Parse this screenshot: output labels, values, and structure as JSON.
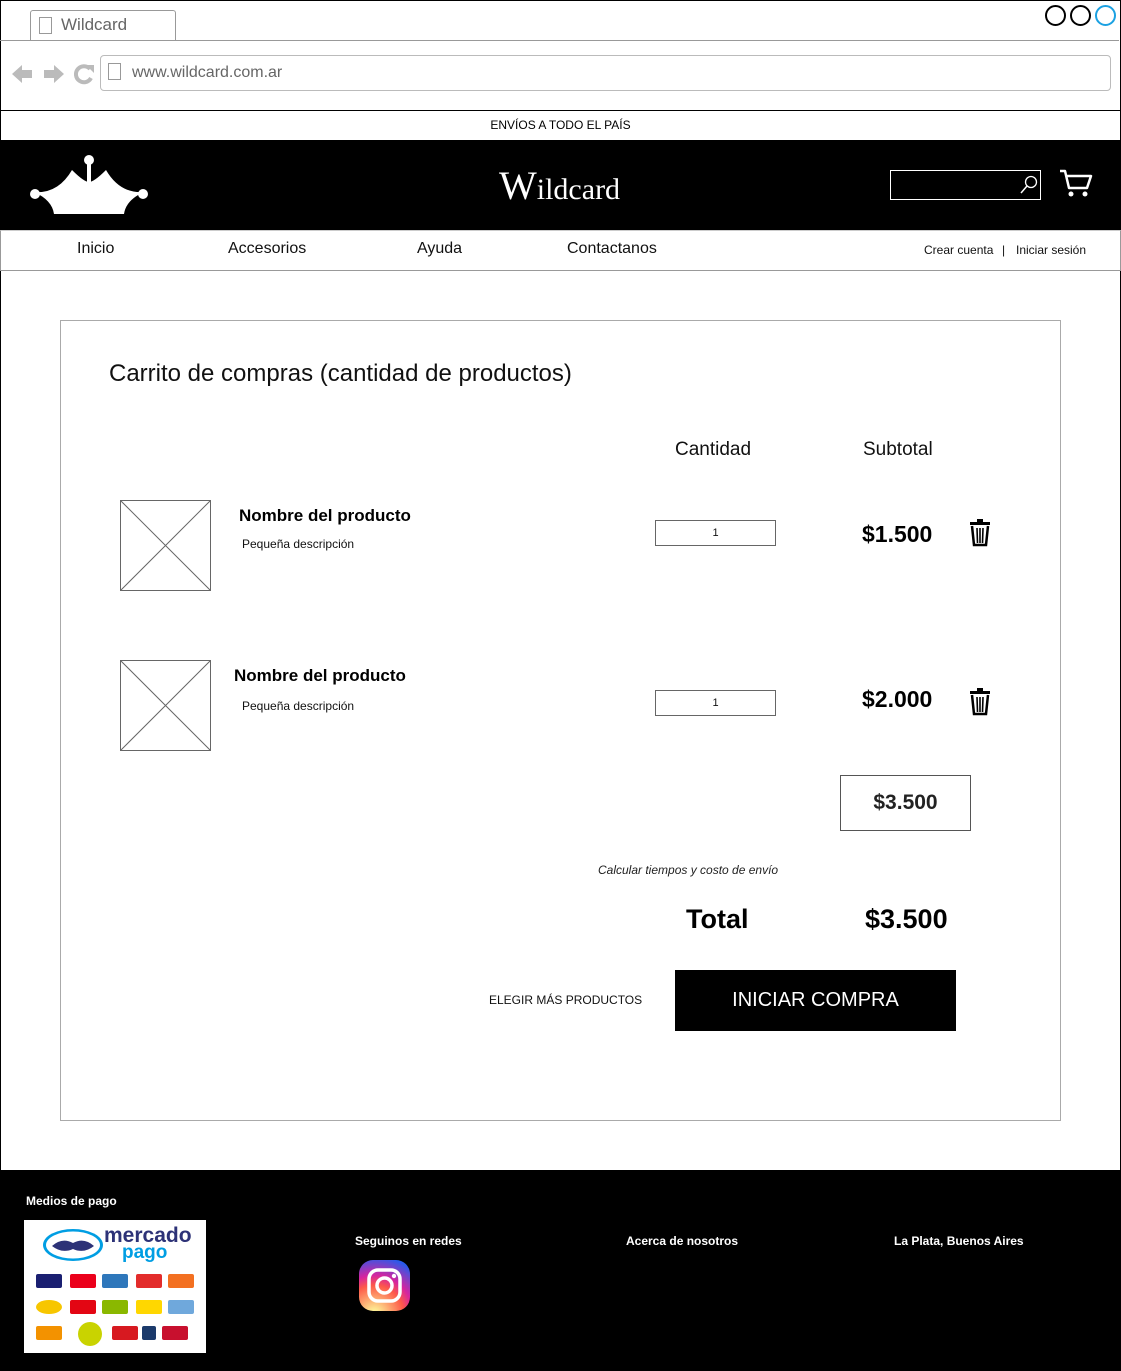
{
  "browser": {
    "tab_title": "Wildcard",
    "url": "www.wildcard.com.ar"
  },
  "promo_bar": "ENVÍOS A TODO EL PAÍS",
  "header": {
    "brand_initial": "W",
    "brand_rest": "ildcard"
  },
  "nav": {
    "items": [
      "Inicio",
      "Accesorios",
      "Ayuda",
      "Contactanos"
    ],
    "create_account": "Crear cuenta",
    "separator": "|",
    "login": "Iniciar sesión"
  },
  "cart": {
    "title": "Carrito de compras (cantidad de productos)",
    "col_quantity": "Cantidad",
    "col_subtotal": "Subtotal",
    "items": [
      {
        "name": "Nombre del producto",
        "description": "Pequeña descripción",
        "quantity": "1",
        "subtotal": "$1.500"
      },
      {
        "name": "Nombre del producto",
        "description": "Pequeña descripción",
        "quantity": "1",
        "subtotal": "$2.000"
      }
    ],
    "sum": "$3.500",
    "shipping_link": "Calcular tiempos y costo de envío",
    "total_label": "Total",
    "total_value": "$3.500",
    "more_products": "ELEGIR MÁS PRODUCTOS",
    "checkout": "INICIAR COMPRA"
  },
  "footer": {
    "payments_title": "Medios de pago",
    "payment_brand_line1": "mercado",
    "payment_brand_line2": "pago",
    "social_title": "Seguinos en redes",
    "about": "Acerca de nosotros",
    "location": "La Plata, Buenos Aires"
  },
  "colors": {
    "header_bg": "#000000",
    "accent_blue": "#1ba1e2",
    "mercadopago_blue": "#009ee3",
    "mercadopago_navy": "#2d3277"
  }
}
